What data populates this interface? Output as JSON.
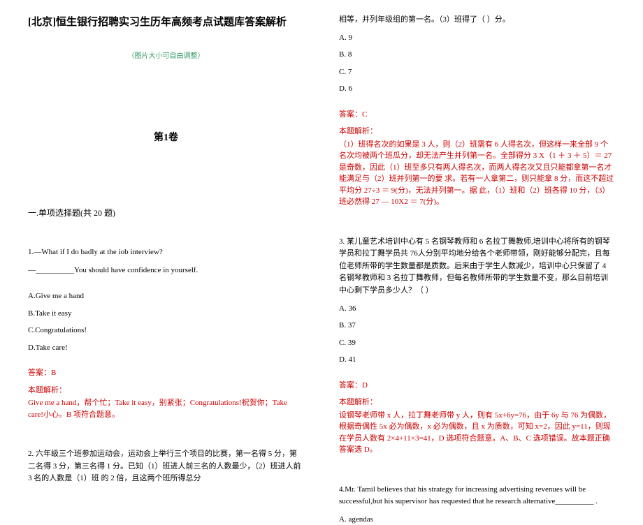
{
  "doc_title": "[北京]恒生银行招聘实习生历年高频考点试题库答案解析",
  "img_note": "（图片大小可自由调整）",
  "volume_title": "第1卷",
  "section_title": "一.单项选择题(共 20 题)",
  "q1": {
    "stem_line1": "1.—What if I do badly at the iob interview?",
    "stem_line2": "—__________You should have confidence in yourself.",
    "opt_a": "A.Give me a hand",
    "opt_b": "B.Take it easy",
    "opt_c": "C.Congratulations!",
    "opt_d": "D.Take care!",
    "answer": "答案：B",
    "explain_label": "本题解析：",
    "explain": "Give me a hand，帮个忙；Take it easy，别紧张；Congratulations!祝贺你；Take care!小心。B 项符合题意。"
  },
  "q2": {
    "left_part": "2. 六年级三个班参加运动会，运动会上举行三个项目的比赛，第一名得 5 分，第二名得 3 分，第三名得 1 分。已知（1）班进人前三名的人数最少，（2）班进人前 3 名的人数是（1）班 的 2 倍，且这两个班所得总分",
    "right_cont": "相等，并列年级组的第一名。（3）班得了（ ）分。",
    "opt_a": "A. 9",
    "opt_b": "B. 8",
    "opt_c": "C. 7",
    "opt_d": "D. 6",
    "answer": "答案：C",
    "explain_label": "本题解析：",
    "explain": "（1）班得名次的如果是 3 人，则（2）班需有 6 人得名次，但这样一来全部 9 个名次均被两个班瓜分，却无法产生并列第一名。全部得分 3 X（1 ＋ 3 ＋ 5）＝ 27 是奇数，因此（1）班至多只有两人得名次，而两人得名次又且只能都拿第一名才能满足与（2）班并列第一的要 求。若有一人拿第二，则只能拿 8 分，而这不超过平均分 27÷3 ＝ 9(分)，无法并列第一。据 此，（1）班和（2）班各得 10 分，（3）班必然得 27 — 10X2 ＝ 7(分)。"
  },
  "q3": {
    "stem": "3. 某儿童艺术培训中心有 5 名钢琴教师和 6 名拉丁舞教师,培训中心将所有的钢琴学员和拉丁舞学员共 76人分别平均地分给各个老师带领，刚好能够分配完，且每位老师所带的学生数量都是质数。后来由于学生人数减少，培训中心只保留了 4 名钢琴教师和 3 名拉丁舞教师，但每名教师所带的学生数量不变，那么目前培训中心剩下学员多少人？（   ）",
    "opt_a": "A. 36",
    "opt_b": "B. 37",
    "opt_c": "C. 39",
    "opt_d": "D. 41",
    "answer": "答案：D",
    "explain_label": "本题解析：",
    "explain": "设钢琴老师带 x 人，拉丁舞老师带 y 人，则有 5x+6y=76，由于 6y 与 76 为偶数，根据奇偶性 5x 必为偶数，x 必为偶数，且 x 为质数，可知 x=2，因此 y=11，则现在学员人数有 2×4+11×3=41，D 选项符合题意。A、B、C 选项错误。故本题正确答案选 D。"
  },
  "q4": {
    "stem": "4.Mr. Tamil believes that his strategy for increasing advertising revenues will be successful,but his supervisor has requested that he research alternative__________ .",
    "opt_a": "A. agendas"
  }
}
